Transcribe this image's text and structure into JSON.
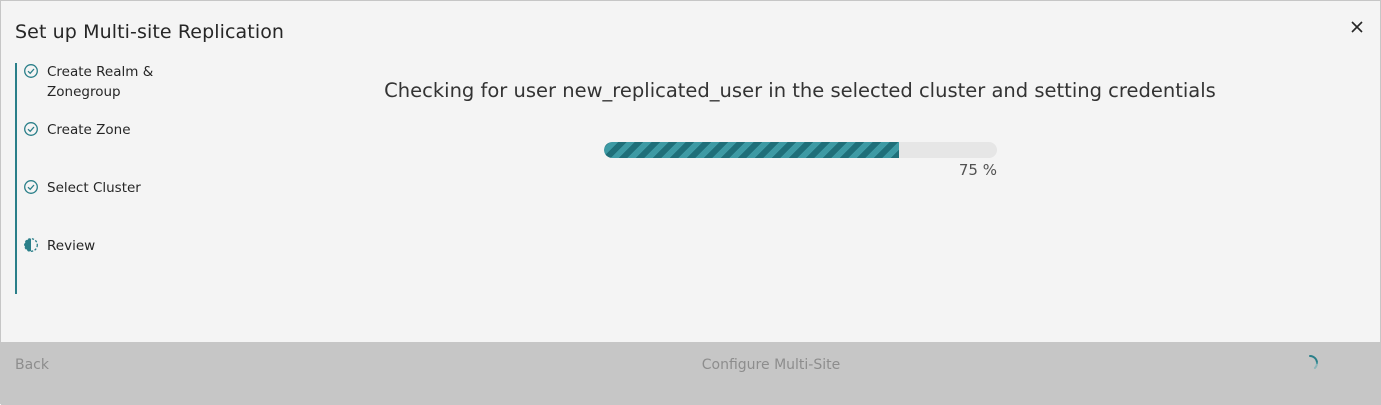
{
  "dialog": {
    "title": "Set up Multi-site Replication",
    "close_icon": "close-icon"
  },
  "steps": [
    {
      "label": "Create Realm & Zonegroup",
      "status": "complete",
      "icon": "checkmark-outline-icon"
    },
    {
      "label": "Create Zone",
      "status": "complete",
      "icon": "checkmark-outline-icon"
    },
    {
      "label": "Select Cluster",
      "status": "complete",
      "icon": "checkmark-outline-icon"
    },
    {
      "label": "Review",
      "status": "current",
      "icon": "incomplete-icon"
    }
  ],
  "main": {
    "headline": "Checking for user new_replicated_user in the selected cluster and setting credentials",
    "progress": {
      "value": 75,
      "label": "75 %"
    }
  },
  "footer": {
    "back_label": "Back",
    "primary_label": "Configure Multi-Site",
    "loading_icon": "loading-spinner-icon"
  },
  "colors": {
    "accent": "#2a7f89",
    "progress_fill": "#1f6f79",
    "progress_stripe": "#3d9aa4",
    "footer_bg": "#c6c6c6",
    "disabled_text": "#8d8d8d"
  }
}
